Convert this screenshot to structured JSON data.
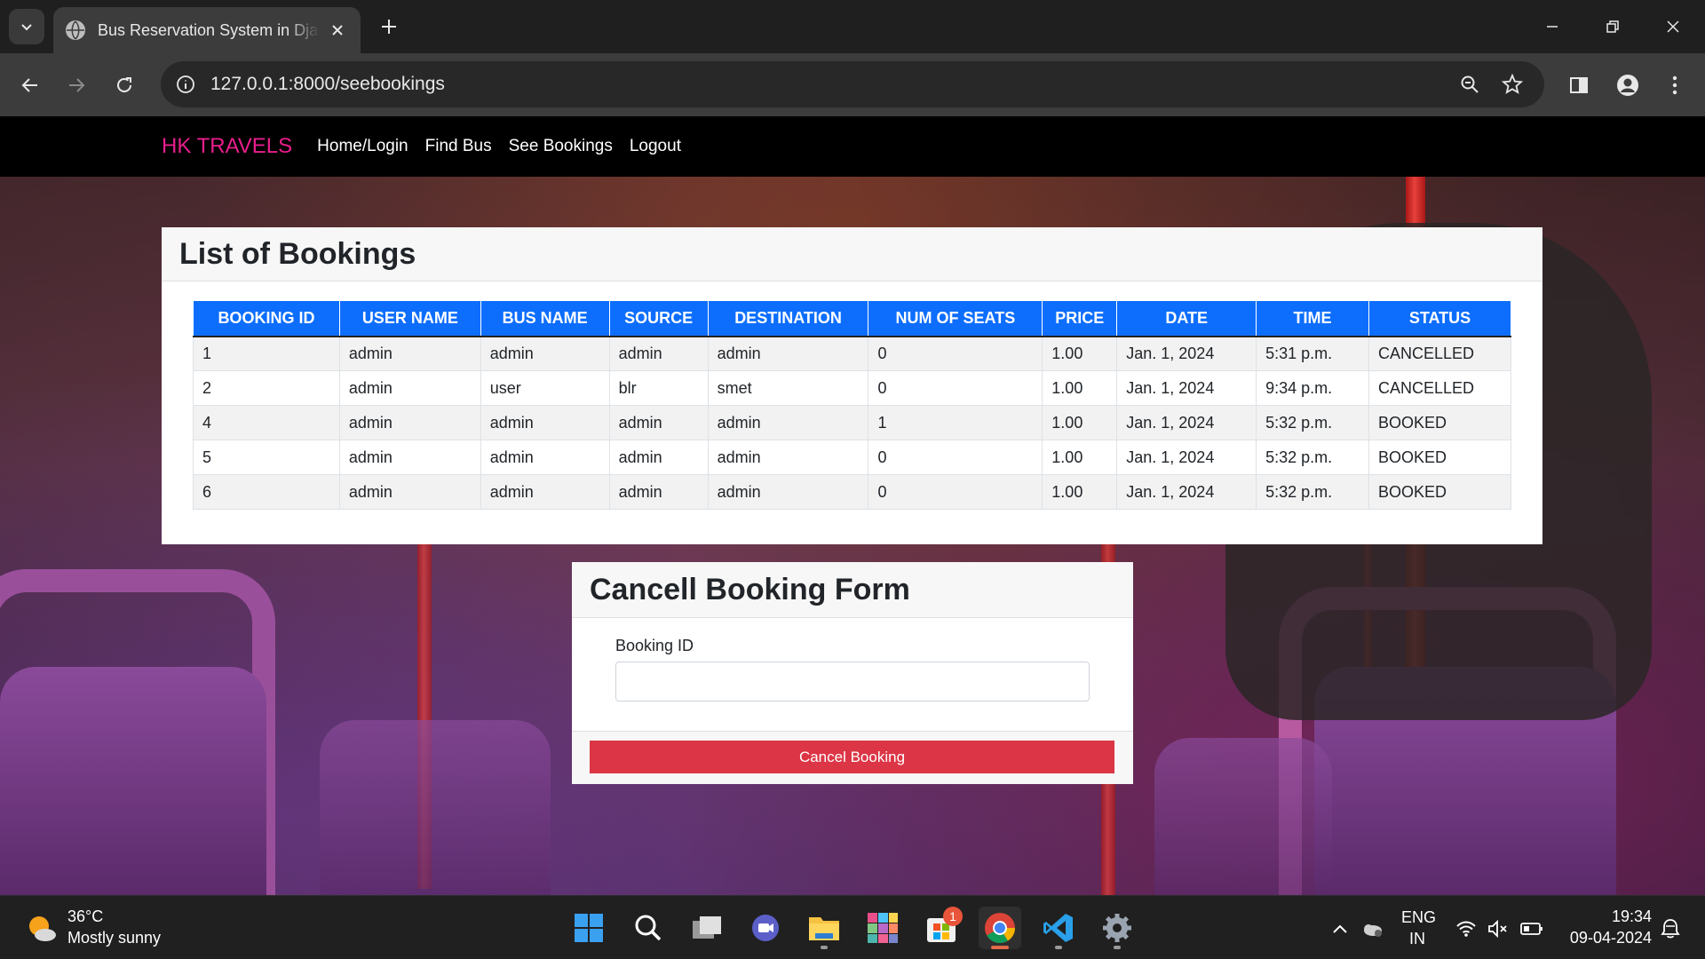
{
  "browser": {
    "tab_title": "Bus Reservation System in Django",
    "url": "127.0.0.1:8000/seebookings"
  },
  "navbar": {
    "brand": "HK TRAVELS",
    "links": [
      "Home/Login",
      "Find Bus",
      "See Bookings",
      "Logout"
    ]
  },
  "bookings": {
    "title": "List of Bookings",
    "columns": [
      "BOOKING ID",
      "USER NAME",
      "BUS NAME",
      "SOURCE",
      "DESTINATION",
      "NUM OF SEATS",
      "PRICE",
      "DATE",
      "TIME",
      "STATUS"
    ],
    "rows": [
      [
        "1",
        "admin",
        "admin",
        "admin",
        "admin",
        "0",
        "1.00",
        "Jan. 1, 2024",
        "5:31 p.m.",
        "CANCELLED"
      ],
      [
        "2",
        "admin",
        "user",
        "blr",
        "smet",
        "0",
        "1.00",
        "Jan. 1, 2024",
        "9:34 p.m.",
        "CANCELLED"
      ],
      [
        "4",
        "admin",
        "admin",
        "admin",
        "admin",
        "1",
        "1.00",
        "Jan. 1, 2024",
        "5:32 p.m.",
        "BOOKED"
      ],
      [
        "5",
        "admin",
        "admin",
        "admin",
        "admin",
        "0",
        "1.00",
        "Jan. 1, 2024",
        "5:32 p.m.",
        "BOOKED"
      ],
      [
        "6",
        "admin",
        "admin",
        "admin",
        "admin",
        "0",
        "1.00",
        "Jan. 1, 2024",
        "5:32 p.m.",
        "BOOKED"
      ]
    ]
  },
  "cancel_form": {
    "title": "Cancell Booking Form",
    "field_label": "Booking ID",
    "field_value": "",
    "button_label": "Cancel Booking"
  },
  "taskbar": {
    "weather_temp": "36°C",
    "weather_desc": "Mostly sunny",
    "store_badge": "1",
    "lang_line1": "ENG",
    "lang_line2": "IN",
    "time": "19:34",
    "date": "09-04-2024"
  },
  "colors": {
    "brand": "#e91e8c",
    "table_header": "#0d6efd",
    "danger": "#dc3545",
    "navbar": "#000000"
  }
}
